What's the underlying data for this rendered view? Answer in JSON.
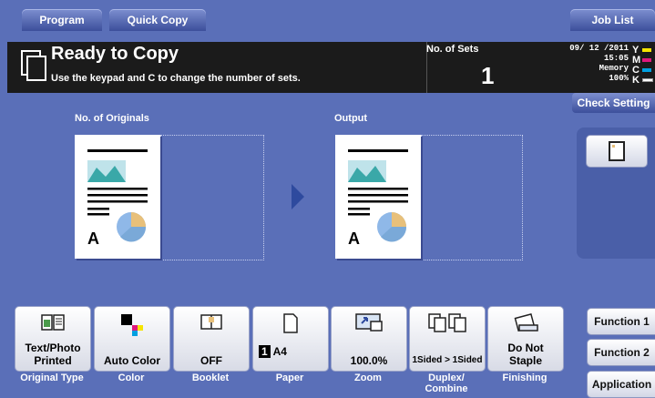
{
  "top_tabs": {
    "program": "Program",
    "quick_copy": "Quick Copy",
    "job_list": "Job List"
  },
  "status": {
    "title": "Ready to Copy",
    "hint": "Use the keypad and C to change the number of sets.",
    "sets_label": "No. of Sets",
    "sets_value": "1",
    "date": "09/ 12 /2011",
    "time": "15:05",
    "memory_label": "Memory",
    "memory_value": "100%",
    "toner": [
      "Y",
      "M",
      "C",
      "K"
    ],
    "toner_colors": [
      "#f5e400",
      "#e0177d",
      "#00a0e0",
      "#222222"
    ]
  },
  "check_setting": "Check Setting",
  "preview": {
    "originals_label": "No. of Originals",
    "output_label": "Output",
    "page_letter": "A"
  },
  "functions": [
    {
      "name": "original-type",
      "text": "Text/Photo\nPrinted",
      "label": "Original Type",
      "icon": "text-photo-icon"
    },
    {
      "name": "color",
      "text": "Auto Color",
      "label": "Color",
      "icon": "color-icon"
    },
    {
      "name": "booklet",
      "text": "OFF",
      "label": "Booklet",
      "icon": "booklet-icon"
    },
    {
      "name": "paper",
      "text": "A4",
      "badge": "1",
      "label": "Paper",
      "icon": "paper-icon"
    },
    {
      "name": "zoom",
      "text": "100.0%",
      "label": "Zoom",
      "icon": "zoom-icon"
    },
    {
      "name": "duplex",
      "text": "1Sided > 1Sided",
      "label": "Duplex/\nCombine",
      "icon": "duplex-icon"
    },
    {
      "name": "finishing",
      "text": "Do Not\nStaple",
      "label": "Finishing",
      "icon": "staple-icon"
    }
  ],
  "side_buttons": {
    "function1": "Function 1",
    "function2": "Function 2",
    "application": "Application"
  }
}
